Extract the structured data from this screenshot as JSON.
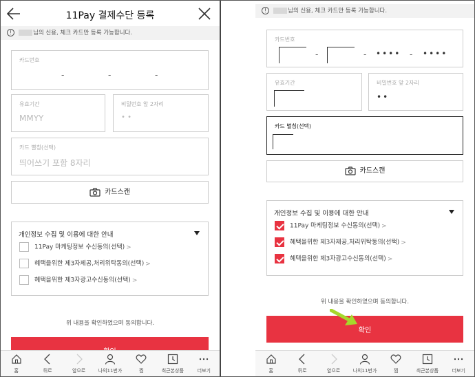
{
  "header": {
    "title": "11Pay 결제수단 등록"
  },
  "notice": {
    "text": "님의 신용, 체크 카드만 등록 가능합니다."
  },
  "fields": {
    "card_number_label": "카드번호",
    "card_number_sep": "-",
    "card_number_mask": "••••",
    "expiry_label": "유효기간",
    "expiry_placeholder": "MMYY",
    "pin_label": "비밀번호 앞 2자리",
    "pin_placeholder": "• •",
    "pin_value": "••",
    "alias_label": "카드 별칭(선택)",
    "alias_placeholder": "띄어쓰기 포함 8자리"
  },
  "scan": {
    "label": "카드스캔"
  },
  "consent": {
    "title": "개인정보 수집 및 이용에 대한 안내",
    "items": [
      {
        "label": "11Pay 마케팅정보 수신동의(선택)"
      },
      {
        "label": "혜택을위한 제3자제공,처리위탁동의(선택)"
      },
      {
        "label": "혜택을위한 제3자광고수신동의(선택)"
      }
    ],
    "chevron": ">"
  },
  "agree_text": "위 내용을 확인하였으며 동의합니다.",
  "confirm_label": "확인",
  "tabbar": [
    {
      "label": "홈",
      "icon": "home-icon"
    },
    {
      "label": "뒤로",
      "icon": "back-chevron-icon"
    },
    {
      "label": "앞으로",
      "icon": "forward-chevron-icon"
    },
    {
      "label": "나의11번가",
      "icon": "my-account-icon"
    },
    {
      "label": "찜",
      "icon": "heart-icon"
    },
    {
      "label": "최근본상품",
      "icon": "recent-clock-icon"
    },
    {
      "label": "더보기",
      "icon": "more-dots-icon"
    }
  ],
  "colors": {
    "accent": "#e83341",
    "annotation_arrow": "#a6d82b"
  }
}
